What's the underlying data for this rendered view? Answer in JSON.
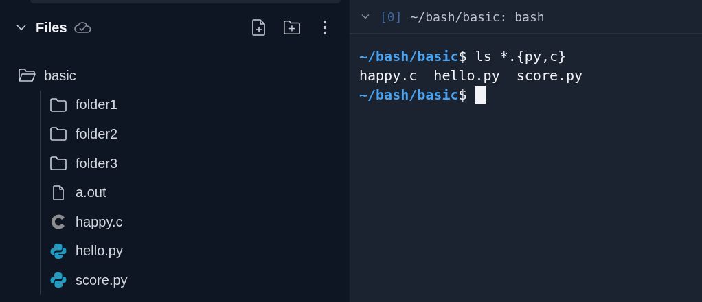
{
  "files_panel": {
    "title": "Files",
    "expanded": true,
    "tree": [
      {
        "name": "basic",
        "kind": "folder",
        "expanded": true,
        "children": [
          {
            "name": "folder1",
            "kind": "folder"
          },
          {
            "name": "folder2",
            "kind": "folder"
          },
          {
            "name": "folder3",
            "kind": "folder"
          },
          {
            "name": "a.out",
            "kind": "file"
          },
          {
            "name": "happy.c",
            "kind": "c"
          },
          {
            "name": "hello.py",
            "kind": "python"
          },
          {
            "name": "score.py",
            "kind": "python"
          }
        ]
      }
    ]
  },
  "terminal": {
    "index": "[0]",
    "title": "~/bash/basic: bash",
    "expanded": true,
    "lines": [
      {
        "kind": "prompt",
        "path": "~/bash/basic",
        "symbol": "$",
        "command": "ls *.{py,c}"
      },
      {
        "kind": "output",
        "text": "happy.c  hello.py  score.py"
      },
      {
        "kind": "prompt",
        "path": "~/bash/basic",
        "symbol": "$",
        "cursor": true
      }
    ]
  }
}
